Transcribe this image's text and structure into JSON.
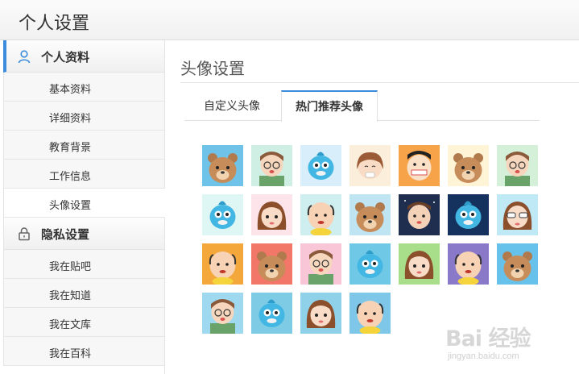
{
  "header": {
    "title": "个人设置"
  },
  "sidebar": {
    "groups": [
      {
        "label": "个人资料",
        "icon": "user-icon",
        "items": [
          {
            "label": "基本资料"
          },
          {
            "label": "详细资料"
          },
          {
            "label": "教育背景"
          },
          {
            "label": "工作信息"
          },
          {
            "label": "头像设置"
          }
        ]
      },
      {
        "label": "隐私设置",
        "icon": "lock-icon",
        "items": [
          {
            "label": "我在贴吧"
          },
          {
            "label": "我在知道"
          },
          {
            "label": "我在文库"
          },
          {
            "label": "我在百科"
          }
        ]
      }
    ],
    "active_item": "头像设置"
  },
  "main": {
    "title": "头像设置",
    "tabs": [
      {
        "label": "自定义头像"
      },
      {
        "label": "热门推荐头像"
      }
    ],
    "active_tab": "热门推荐头像",
    "avatars": [
      {
        "name": "bear",
        "bg": "#6fc3e8"
      },
      {
        "name": "boy-glasses",
        "bg": "#cfeee4"
      },
      {
        "name": "blue-fish",
        "bg": "#d8eefa"
      },
      {
        "name": "girl-eating",
        "bg": "#fbefdc"
      },
      {
        "name": "boy-toothbrush",
        "bg": "#f6a34a"
      },
      {
        "name": "bear",
        "bg": "#fff4d6"
      },
      {
        "name": "boy-glasses",
        "bg": "#d4f0d8"
      },
      {
        "name": "blue-fish",
        "bg": "#dff7f4"
      },
      {
        "name": "girl-pink",
        "bg": "#fde4ea"
      },
      {
        "name": "bald-man",
        "bg": "#cfeef0"
      },
      {
        "name": "bear",
        "bg": "#bfe4f2"
      },
      {
        "name": "boy-night",
        "bg": "#1f2d4f"
      },
      {
        "name": "blue-fish",
        "bg": "#15315e"
      },
      {
        "name": "girl-sunglasses",
        "bg": "#bfe9f5"
      },
      {
        "name": "bald-man",
        "bg": "#f4a83c"
      },
      {
        "name": "bear",
        "bg": "#f27769"
      },
      {
        "name": "boy-glasses",
        "bg": "#f9c6d8"
      },
      {
        "name": "blue-fish",
        "bg": "#6fc9e6"
      },
      {
        "name": "girl-pink",
        "bg": "#a8dd8a"
      },
      {
        "name": "bald-man",
        "bg": "#8a79c9"
      },
      {
        "name": "bear",
        "bg": "#66c2ea"
      },
      {
        "name": "boy-glasses",
        "bg": "#9fd9ef"
      },
      {
        "name": "blue-fish",
        "bg": "#7ecbe5"
      },
      {
        "name": "girl-pink",
        "bg": "#8fd1e8"
      },
      {
        "name": "bald-man",
        "bg": "#7ec7e9"
      }
    ]
  },
  "watermark": {
    "main": "Bai 经验",
    "sub": "jingyan.baidu.com"
  },
  "colors": {
    "accent": "#3b8cdc"
  }
}
